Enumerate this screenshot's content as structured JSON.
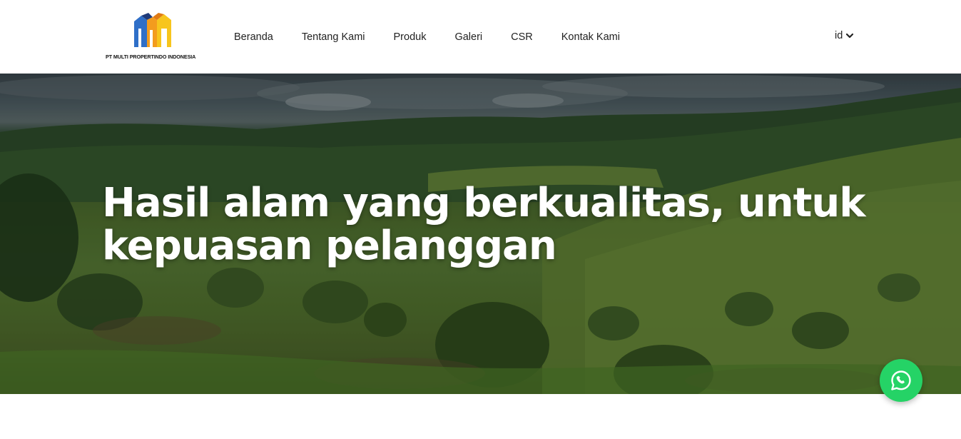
{
  "brand": {
    "company_name": "PT  MULTI PROPERTINDO INDONESIA",
    "logo_icon": "building-logo-icon",
    "colors": {
      "blue": "#2f6fc8",
      "orange": "#f39c1e",
      "yellow": "#f7c51d",
      "navy": "#1f3a7a"
    }
  },
  "nav": {
    "items": [
      {
        "label": "Beranda"
      },
      {
        "label": "Tentang Kami"
      },
      {
        "label": "Produk"
      },
      {
        "label": "Galeri"
      },
      {
        "label": "CSR"
      },
      {
        "label": "Kontak Kami"
      }
    ]
  },
  "language": {
    "selected": "id",
    "icon": "chevron-down-icon"
  },
  "hero": {
    "title_line1": "Hasil alam yang berkualitas, untuk",
    "title_line2": "kepuasan pelanggan",
    "background": "hillside-plantation-photo"
  },
  "whatsapp": {
    "icon": "whatsapp-icon",
    "color": "#25d366"
  }
}
